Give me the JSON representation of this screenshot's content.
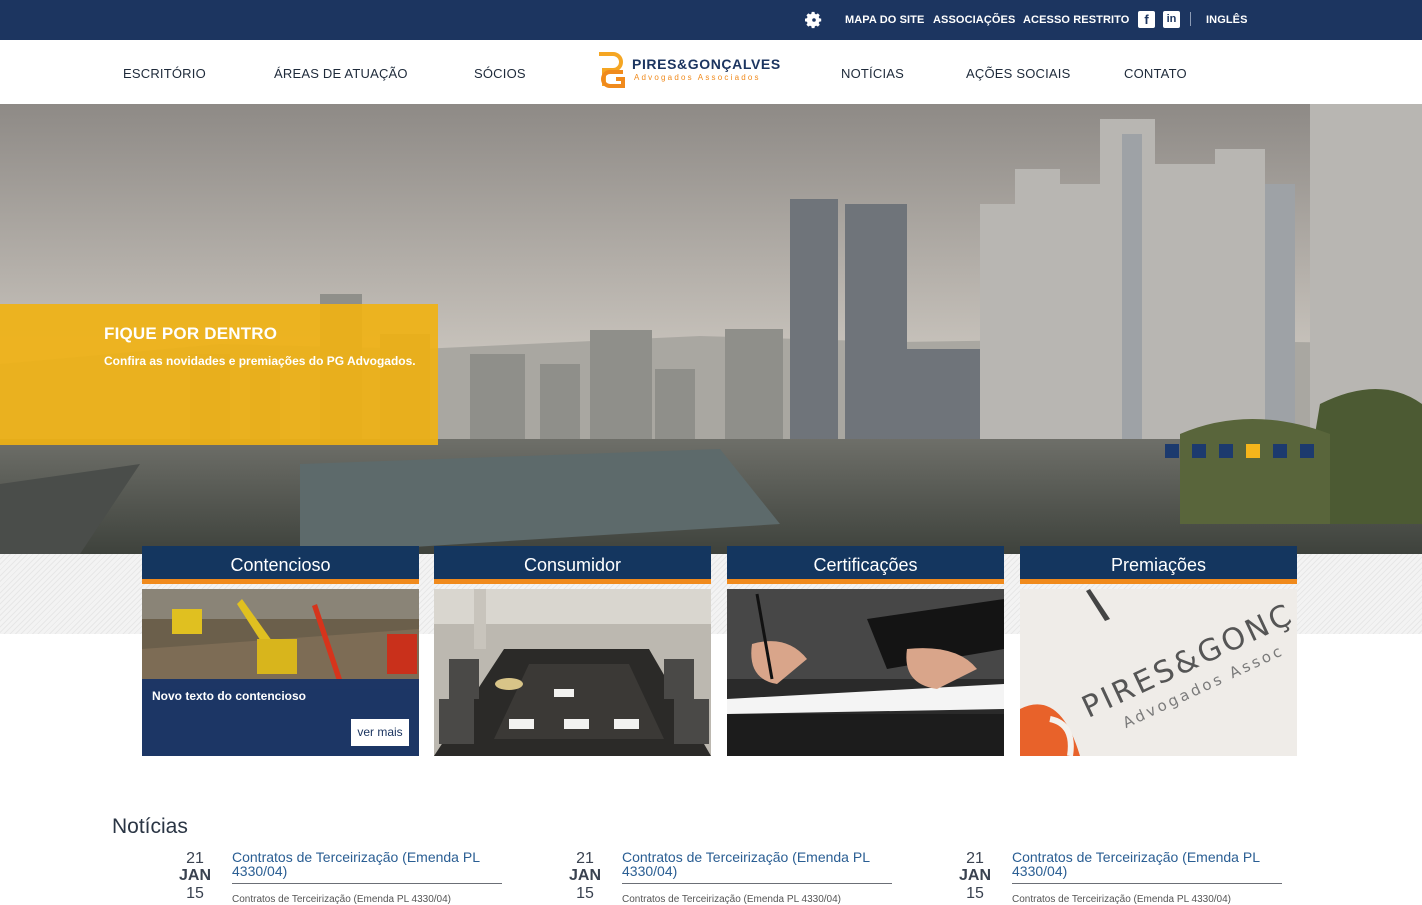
{
  "topbar": {
    "links": [
      "MAPA DO SITE",
      "ASSOCIAÇÕES",
      "ACESSO RESTRITO"
    ],
    "social": [
      "f",
      "in"
    ],
    "language": "INGLÊS"
  },
  "nav": {
    "items": [
      "ESCRITÓRIO",
      "ÁREAS DE ATUAÇÃO",
      "SÓCIOS",
      "NOTÍCIAS",
      "AÇÕES SOCIAIS",
      "CONTATO"
    ],
    "logo": {
      "brand": "PIRES&GONÇALVES",
      "tagline": "Advogados Associados"
    }
  },
  "hero": {
    "title": "FIQUE POR DENTRO",
    "text": "Confira as novidades e premiações do PG Advogados.",
    "slide_count": 6,
    "active_slide": 4
  },
  "cards": [
    {
      "title": "Contencioso",
      "overlay_text": "Novo texto do contencioso",
      "button": "ver mais"
    },
    {
      "title": "Consumidor"
    },
    {
      "title": "Certificações"
    },
    {
      "title": "Premiações",
      "image_text": "PIRES&GONÇ",
      "image_sub": "Advogados Assoc"
    }
  ],
  "news": {
    "heading": "Notícias",
    "items": [
      {
        "day": "21",
        "month": "JAN",
        "year": "15",
        "title": "Contratos de Terceirização (Emenda PL 4330/04)",
        "body": "Contratos de Terceirização (Emenda PL 4330/04)"
      },
      {
        "day": "21",
        "month": "JAN",
        "year": "15",
        "title": "Contratos de Terceirização (Emenda PL 4330/04)",
        "body": "Contratos de Terceirização (Emenda PL 4330/04)"
      },
      {
        "day": "21",
        "month": "JAN",
        "year": "15",
        "title": "Contratos de Terceirização (Emenda PL 4330/04)",
        "body": "Contratos de Terceirização (Emenda PL 4330/04)"
      }
    ]
  },
  "colors": {
    "navy": "#1c3560",
    "orange": "#f08a1c",
    "gold": "#f0b214"
  }
}
